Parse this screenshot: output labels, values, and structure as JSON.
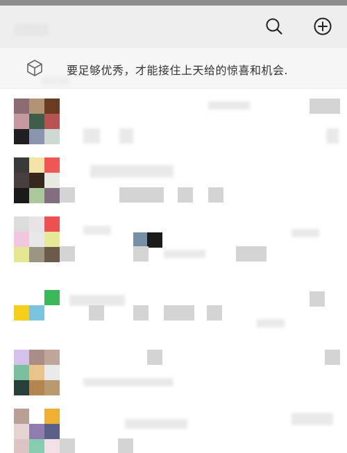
{
  "header": {
    "search_icon": "search-icon",
    "add_icon": "plus-circle-icon"
  },
  "banner": {
    "icon": "cube-icon",
    "text": "要足够优秀，才能接住上天给的惊喜和机会."
  },
  "colors": {
    "header_bg": "#eeeeee",
    "banner_bg": "#f6f6f6",
    "status_strip": "#8c8c8c",
    "banner_text": "#333333"
  },
  "chats": [
    {
      "avatar": [
        "#8d6b72",
        "#b29376",
        "#6b3b21",
        "#c49a9e",
        "#3d5c4a",
        "#b85354",
        "#1f1f22",
        "#8996ad",
        "#cfd9d4"
      ]
    },
    {
      "avatar": [
        "#3a3a3a",
        "#f4e3a7",
        "#ef5656",
        "#4a3f3f",
        "#38271f",
        "#e8e9e0",
        "#191919",
        "#a9c79b",
        "#826e7e"
      ]
    },
    {
      "avatar": [
        "#dcdcdc",
        "#e7e3e6",
        "#ed5050",
        "#f1c6df",
        "#e8e8e8",
        "#e6e99a",
        "#e5e592",
        "#9b9582",
        "#6c5a4b"
      ]
    },
    {
      "avatar": [
        "#ffffff",
        "#ffffff",
        "#3cb65a",
        "#f5cf1c",
        "#7bc4e0",
        "#ffffff",
        "#ffffff",
        "#ffffff",
        "#ffffff"
      ]
    },
    {
      "avatar": [
        "#d3c2ea",
        "#a98d86",
        "#bda79b",
        "#7bbf9e",
        "#e8c38a",
        "#eaeaea",
        "#263f3b",
        "#b38551",
        "#b99970"
      ]
    },
    {
      "avatar": [
        "#b99f96",
        "#ffffff",
        "#efb036",
        "#e6d4d4",
        "#8f7bae",
        "#5a6088",
        "#ddc4c4",
        "#86ccb0",
        "#f1e0e6"
      ]
    }
  ]
}
